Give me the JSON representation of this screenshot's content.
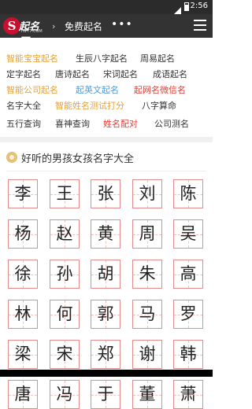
{
  "status": {
    "time": "2:56"
  },
  "header": {
    "logo_text": "起名网",
    "logo_mark": "S",
    "logo_url": "YW77.COM",
    "breadcrumb": "免费起名",
    "more": "•••"
  },
  "quick_links": [
    [
      {
        "label": "智能宝宝起名",
        "color": "orange"
      },
      {
        "label": "生辰八字起名",
        "color": "dark"
      },
      {
        "label": "周易起名",
        "color": "dark"
      }
    ],
    [
      {
        "label": "定字起名",
        "color": "dark"
      },
      {
        "label": "唐诗起名",
        "color": "dark"
      },
      {
        "label": "宋词起名",
        "color": "dark"
      },
      {
        "label": "成语起名",
        "color": "dark"
      }
    ],
    [
      {
        "label": "智能公司起名",
        "color": "orange"
      },
      {
        "label": "起英文起名",
        "color": "blue"
      },
      {
        "label": "起网名微信名",
        "color": "red"
      }
    ],
    [
      {
        "label": "名字大全",
        "color": "dark"
      },
      {
        "label": "智能姓名测试打分",
        "color": "orange"
      },
      {
        "label": "八字算命",
        "color": "dark"
      }
    ],
    [
      {
        "label": "五行查询",
        "color": "dark"
      },
      {
        "label": "喜神查询",
        "color": "dark"
      },
      {
        "label": "姓名配对",
        "color": "red"
      },
      {
        "label": "公司测名",
        "color": "dark"
      }
    ]
  ],
  "section": {
    "title": "好听的男孩女孩名字大全"
  },
  "surnames": [
    [
      "李",
      "王",
      "张",
      "刘",
      "陈"
    ],
    [
      "杨",
      "赵",
      "黄",
      "周",
      "吴"
    ],
    [
      "徐",
      "孙",
      "胡",
      "朱",
      "高"
    ],
    [
      "林",
      "何",
      "郭",
      "马",
      "罗"
    ],
    [
      "梁",
      "宋",
      "郑",
      "谢",
      "韩"
    ],
    [
      "唐",
      "冯",
      "于",
      "董",
      "萧"
    ]
  ],
  "colors": {
    "orange": "#e8a23a",
    "blue": "#4f9ad8",
    "red": "#d9413a",
    "dark": "#333333",
    "cell_border": "#e38b8b",
    "topbar": "#333333"
  }
}
